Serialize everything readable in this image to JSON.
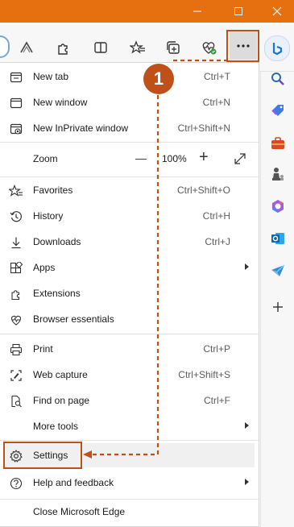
{
  "window": {
    "buttons": [
      "minimize",
      "maximize",
      "close"
    ]
  },
  "toolbar": {
    "icons": [
      "profile-icon",
      "read-aloud-icon",
      "extensions-icon",
      "split-screen-icon",
      "favorites-icon",
      "collections-icon",
      "browser-essentials-icon",
      "settings-and-more-icon",
      "copilot-icon"
    ]
  },
  "annotation": {
    "step_number": "1",
    "color": "#c0501a"
  },
  "menu": {
    "new_tab": {
      "label": "New tab",
      "shortcut": "Ctrl+T"
    },
    "new_window": {
      "label": "New window",
      "shortcut": "Ctrl+N"
    },
    "new_inprivate": {
      "label": "New InPrivate window",
      "shortcut": "Ctrl+Shift+N"
    },
    "zoom": {
      "label": "Zoom",
      "minus": "—",
      "value": "100%",
      "plus": "+"
    },
    "favorites": {
      "label": "Favorites",
      "shortcut": "Ctrl+Shift+O"
    },
    "history": {
      "label": "History",
      "shortcut": "Ctrl+H"
    },
    "downloads": {
      "label": "Downloads",
      "shortcut": "Ctrl+J"
    },
    "apps": {
      "label": "Apps"
    },
    "extensions": {
      "label": "Extensions"
    },
    "browser_essentials": {
      "label": "Browser essentials"
    },
    "print": {
      "label": "Print",
      "shortcut": "Ctrl+P"
    },
    "web_capture": {
      "label": "Web capture",
      "shortcut": "Ctrl+Shift+S"
    },
    "find_on_page": {
      "label": "Find on page",
      "shortcut": "Ctrl+F"
    },
    "more_tools": {
      "label": "More tools"
    },
    "settings": {
      "label": "Settings"
    },
    "help": {
      "label": "Help and feedback"
    },
    "close_edge": {
      "label": "Close Microsoft Edge"
    }
  },
  "sidebar": {
    "icons": [
      "search-icon",
      "shopping-tag-icon",
      "tools-icon",
      "games-icon",
      "microsoft-365-icon",
      "outlook-icon",
      "send-icon",
      "add-icon"
    ]
  },
  "colors": {
    "titlebar": "#e6700f",
    "highlight": "#c0501a",
    "accent": "#0f6cbd"
  }
}
